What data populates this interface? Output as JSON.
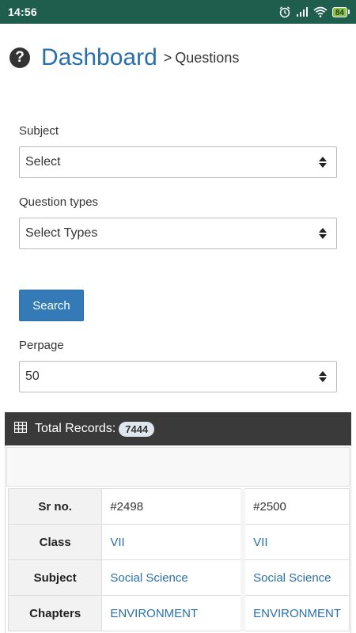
{
  "status_bar": {
    "time": "14:56",
    "battery": "84",
    "icons": [
      "alarm-icon",
      "signal-icon",
      "wifi-icon",
      "battery-icon"
    ]
  },
  "header": {
    "title": "Dashboard",
    "separator": ">",
    "current": "Questions",
    "icon": "help-icon"
  },
  "form": {
    "subject_label": "Subject",
    "subject_value": "Select",
    "question_types_label": "Question types",
    "question_types_value": "Select Types",
    "search_label": "Search",
    "perpage_label": "Perpage",
    "perpage_value": "50"
  },
  "records": {
    "total_label": "Total Records:",
    "total_count": "7444",
    "row_headers": [
      "Sr no.",
      "Class",
      "Subject",
      "Chapters"
    ],
    "columns": [
      {
        "sr_no": "#2498",
        "class": "VII",
        "subject": "Social Science",
        "chapters": "ENVIRONMENT"
      },
      {
        "sr_no": "#2500",
        "class": "VII",
        "subject": "Social Science",
        "chapters": "ENVIRONMENT"
      }
    ]
  },
  "colors": {
    "status_bar": "#1f5d4d",
    "primary": "#337ab7",
    "link": "#2a6faa",
    "panel_header": "#3a3a3a"
  }
}
